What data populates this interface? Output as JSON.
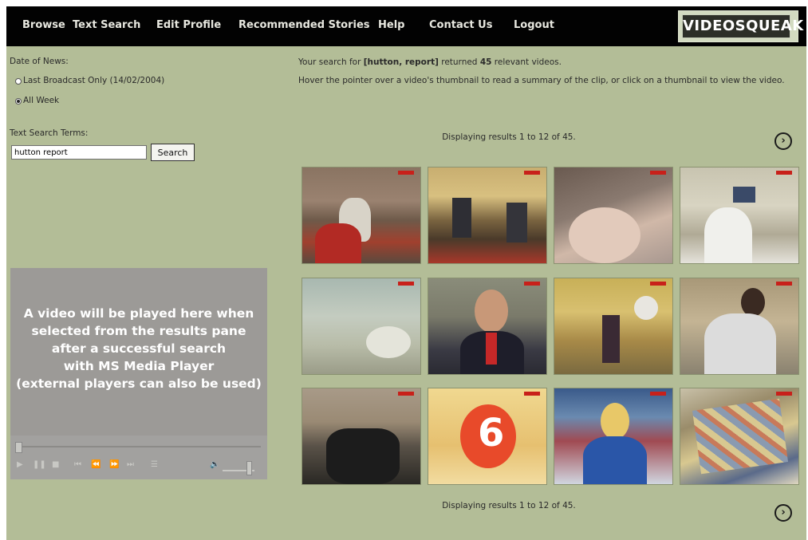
{
  "nav": {
    "items": [
      {
        "label": "Browse",
        "id": "browse"
      },
      {
        "label": "Text Search",
        "id": "text-search"
      },
      {
        "label": "Edit Profile",
        "id": "edit-profile"
      },
      {
        "label": "Recommended Stories",
        "id": "recommended-stories"
      },
      {
        "label": "Help",
        "id": "help"
      },
      {
        "label": "Contact Us",
        "id": "contact-us"
      },
      {
        "label": "Logout",
        "id": "logout"
      }
    ],
    "logo_text": "VIDEOSQUEAK"
  },
  "sidebar": {
    "date_label": "Date of News:",
    "date_options": [
      {
        "label": "Last Broadcast Only (14/02/2004)",
        "selected": false
      },
      {
        "label": "All Week",
        "selected": true
      }
    ],
    "terms_label": "Text Search Terms:",
    "search_value": "hutton report",
    "search_button": "Search"
  },
  "player": {
    "message": "A video will be played here when\nselected from the results pane\nafter a successful search\n    with MS Media Player\n(external players can also be used)"
  },
  "results": {
    "summary_prefix": "Your search for ",
    "query_terms": "[hutton, report]",
    "summary_mid": " returned ",
    "count": "45",
    "summary_suffix": " relevant videos.",
    "hint": "Hover the pointer over a video's thumbnail to read a summary of the clip, or click on a thumbnail to view the video.",
    "status_top": "Displaying results 1 to 12 of 45.",
    "status_bottom": "Displaying results 1 to 12 of 45.",
    "next_glyph": "›"
  },
  "colors": {
    "page_background": "#b3bd97",
    "nav_background": "#020202",
    "player_background": "#9c9a97",
    "logo_background": "#2d2f28"
  }
}
